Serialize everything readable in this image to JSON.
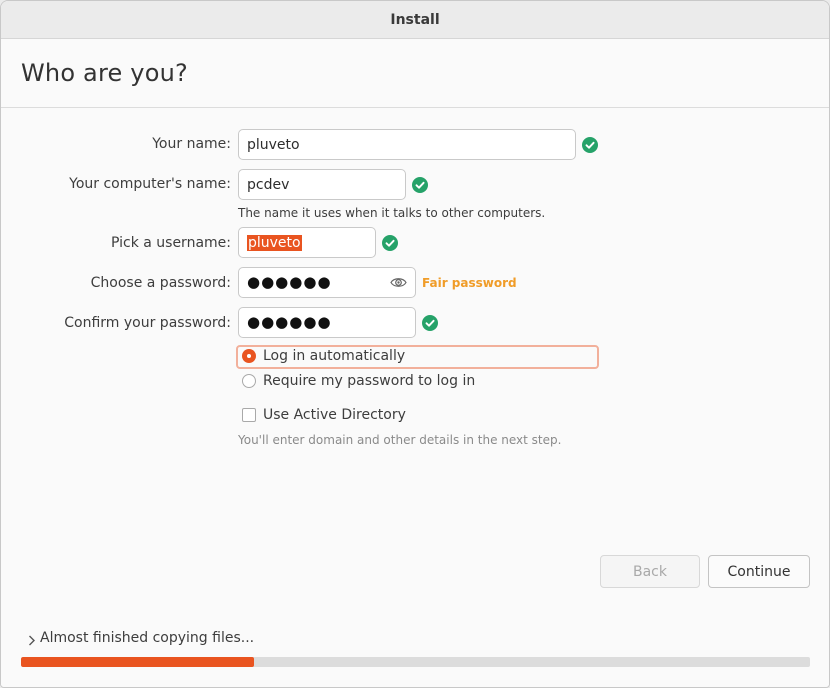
{
  "window": {
    "title": "Install"
  },
  "page": {
    "title": "Who are you?"
  },
  "form": {
    "your_name": {
      "label": "Your name:",
      "value": "pluveto",
      "valid": true
    },
    "computer_name": {
      "label": "Your computer's name:",
      "value": "pcdev",
      "valid": true,
      "hint": "The name it uses when it talks to other computers."
    },
    "username": {
      "label": "Pick a username:",
      "value": "pluveto",
      "valid": true,
      "selected": true
    },
    "password": {
      "label": "Choose a password:",
      "masked_value": "●●●●●●",
      "strength": "Fair password",
      "strength_color": "#f09c28"
    },
    "confirm_password": {
      "label": "Confirm your password:",
      "masked_value": "●●●●●●",
      "valid": true
    },
    "login_options": [
      {
        "label": "Log in automatically",
        "selected": true
      },
      {
        "label": "Require my password to log in",
        "selected": false
      }
    ],
    "active_directory": {
      "label": "Use Active Directory",
      "checked": false,
      "hint": "You'll enter domain and other details in the next step."
    }
  },
  "buttons": {
    "back": "Back",
    "continue": "Continue"
  },
  "progress": {
    "label": "Almost finished copying files...",
    "fraction": 0.295
  },
  "colors": {
    "accent": "#e95420",
    "valid": "#26a269",
    "focus_ring": "#f2b09b"
  }
}
